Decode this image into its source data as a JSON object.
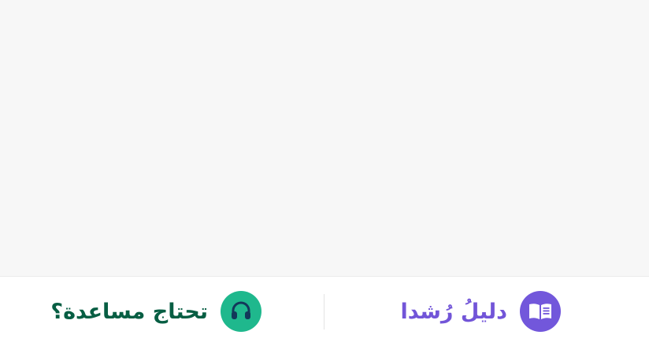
{
  "bottom_bar": {
    "guide": {
      "label": "دليلُ رُشدا",
      "icon": "open-book-icon",
      "color": "#7255d8",
      "icon_bg": "#7257db"
    },
    "help": {
      "label": "تحتاج مساعدة؟",
      "icon": "headset-icon",
      "color": "#075e43",
      "icon_bg": "#1fb88d"
    }
  }
}
